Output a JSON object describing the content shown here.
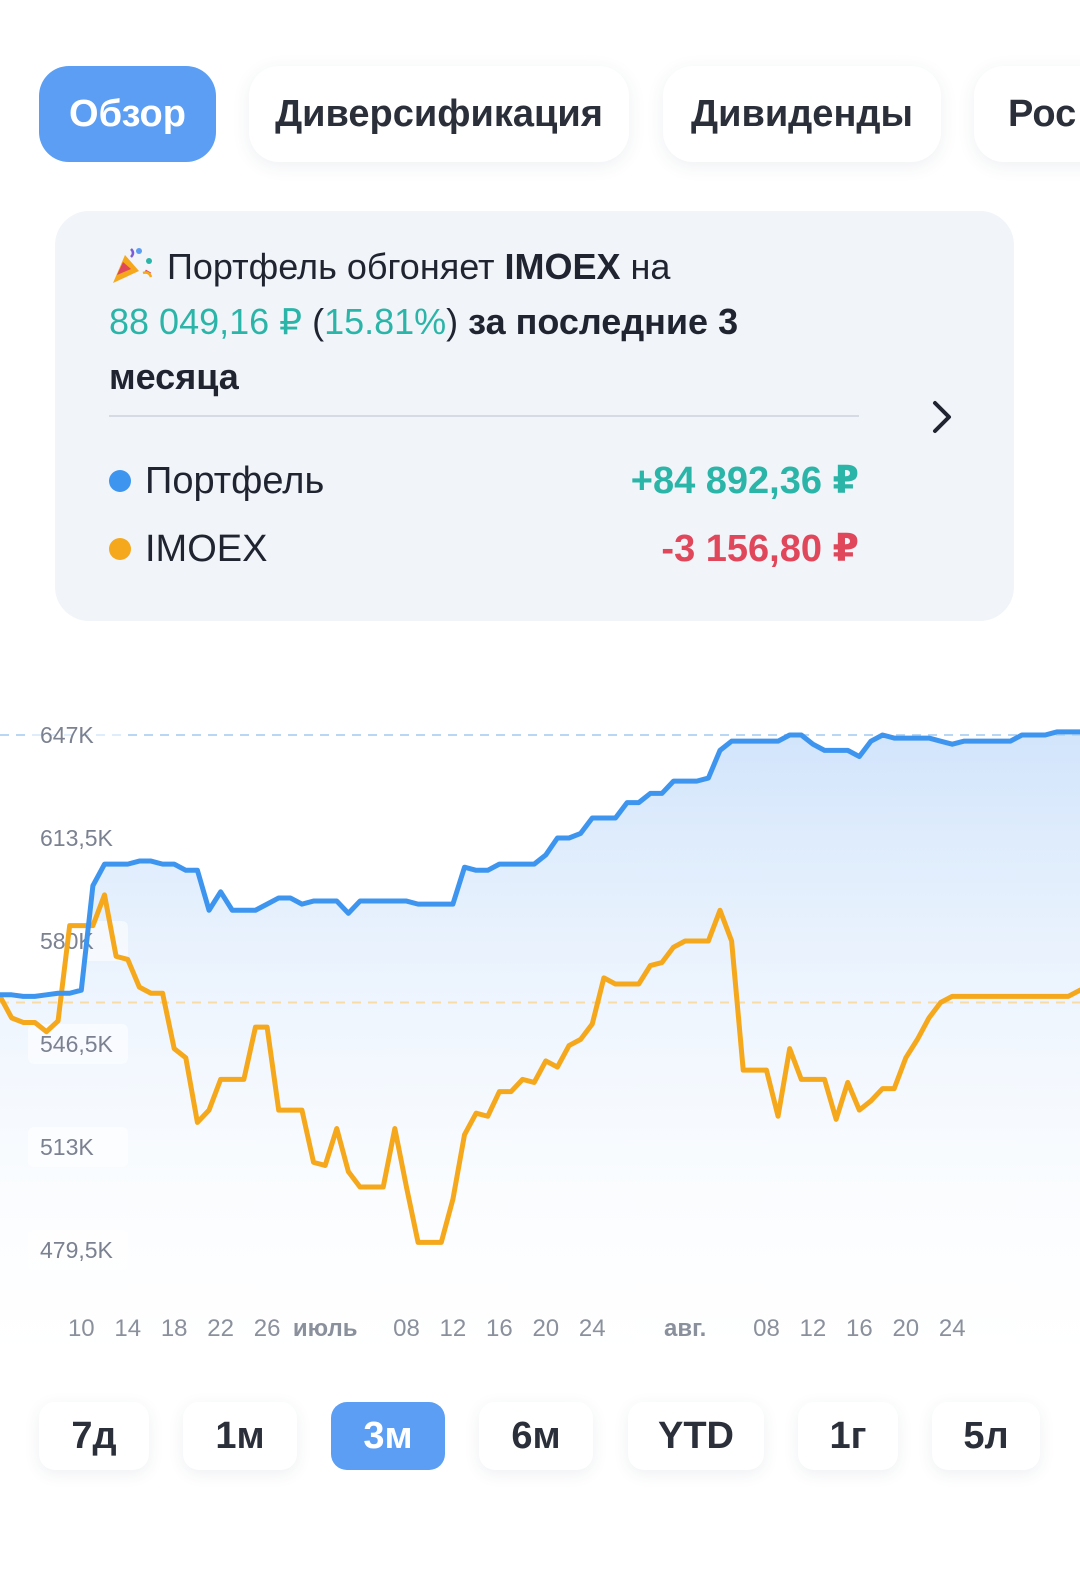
{
  "tabs": [
    {
      "label": "Обзор",
      "active": true
    },
    {
      "label": "Диверсификация",
      "active": false
    },
    {
      "label": "Дивиденды",
      "active": false
    },
    {
      "label": "Рос",
      "active": false
    }
  ],
  "summary": {
    "line1_a": "Портфель обгоняет ",
    "line1_b": "IMOEX",
    "line1_c": " на",
    "amount": "88 049,16 ₽",
    "paren_open": " (",
    "percent": "15.81%",
    "paren_close": ")",
    "rest": " за последние 3 месяца",
    "icon": "party-popper-icon",
    "chevron_icon": "chevron-right-icon"
  },
  "legend": [
    {
      "name": "Портфель",
      "value": "+84 892,36 ₽",
      "color": "#3d95ef",
      "value_color": "#2bb5a8"
    },
    {
      "name": "IMOEX",
      "value": "-3 156,80 ₽",
      "color": "#f5a81c",
      "value_color": "#e0475b"
    }
  ],
  "colors": {
    "accent": "#5b9ef4",
    "portfolio_line": "#3d95ef",
    "imoex_line": "#f5a81c",
    "positive": "#2bb5a8",
    "negative": "#e0475b"
  },
  "chart_data": {
    "type": "line",
    "y_ticks": [
      "647K",
      "613,5K",
      "580K",
      "546,5K",
      "513K",
      "479,5K"
    ],
    "ylim": [
      479500,
      647000
    ],
    "x_tick_labels": [
      "10",
      "14",
      "18",
      "22",
      "26",
      "июль",
      "08",
      "12",
      "16",
      "20",
      "24",
      "авг.",
      "08",
      "12",
      "16",
      "20",
      "24"
    ],
    "x_tick_month": [
      false,
      false,
      false,
      false,
      false,
      true,
      false,
      false,
      false,
      false,
      false,
      true,
      false,
      false,
      false,
      false,
      false
    ],
    "x_tick_index": [
      7,
      11,
      15,
      19,
      23,
      28,
      35,
      39,
      43,
      47,
      51,
      59,
      66,
      70,
      74,
      78,
      82
    ],
    "x_range": [
      0,
      93
    ],
    "reference_lines": [
      647000,
      560000
    ],
    "series": [
      {
        "name": "Портфель",
        "color": "#3d95ef",
        "values": [
          562500,
          562500,
          562000,
          562000,
          562500,
          563000,
          563000,
          564000,
          598000,
          605000,
          605000,
          605000,
          606000,
          606000,
          605000,
          605000,
          603000,
          603000,
          590000,
          596000,
          590000,
          590000,
          590000,
          592000,
          594000,
          594000,
          592000,
          593000,
          593000,
          593000,
          589000,
          593000,
          593000,
          593000,
          593000,
          593000,
          592000,
          592000,
          592000,
          592000,
          604000,
          603000,
          603000,
          605000,
          605000,
          605000,
          605000,
          608000,
          613500,
          613500,
          615000,
          620000,
          620000,
          620000,
          625000,
          625000,
          628000,
          628000,
          632000,
          632000,
          632000,
          633000,
          642000,
          645000,
          645000,
          645000,
          645000,
          645000,
          647000,
          647000,
          644000,
          642000,
          642000,
          642000,
          640000,
          645000,
          647000,
          646000,
          646000,
          646000,
          646000,
          645000,
          644000,
          645000,
          645000,
          645000,
          645000,
          645000,
          647000,
          647000,
          647000,
          648000,
          648000,
          648000
        ]
      },
      {
        "name": "IMOEX",
        "color": "#f5a81c",
        "values": [
          562000,
          555000,
          553500,
          553500,
          550500,
          554000,
          585000,
          585000,
          585000,
          595000,
          575000,
          574000,
          565000,
          563000,
          563000,
          545000,
          542000,
          521000,
          525000,
          535000,
          535000,
          535000,
          552000,
          552000,
          525000,
          525000,
          525000,
          508000,
          507000,
          519000,
          505000,
          500000,
          500000,
          500000,
          519000,
          500000,
          482000,
          482000,
          482000,
          496000,
          517000,
          524000,
          523000,
          531000,
          531000,
          535000,
          534000,
          541000,
          539000,
          546000,
          548000,
          553000,
          568000,
          566000,
          566000,
          566000,
          572000,
          573000,
          578000,
          580000,
          580000,
          580000,
          590000,
          580000,
          538000,
          538000,
          538000,
          523000,
          545000,
          535000,
          535000,
          535000,
          522000,
          534000,
          525000,
          528000,
          532000,
          532000,
          542000,
          548000,
          555000,
          560000,
          562000,
          562000,
          562000,
          562000,
          562000,
          562000,
          562000,
          562000,
          562000,
          562000,
          562000,
          564000
        ]
      }
    ],
    "legend": "none",
    "grid": false
  },
  "periods": [
    {
      "label": "7д",
      "active": false
    },
    {
      "label": "1м",
      "active": false
    },
    {
      "label": "3м",
      "active": true
    },
    {
      "label": "6м",
      "active": false
    },
    {
      "label": "YTD",
      "active": false
    },
    {
      "label": "1г",
      "active": false
    },
    {
      "label": "5л",
      "active": false
    }
  ]
}
